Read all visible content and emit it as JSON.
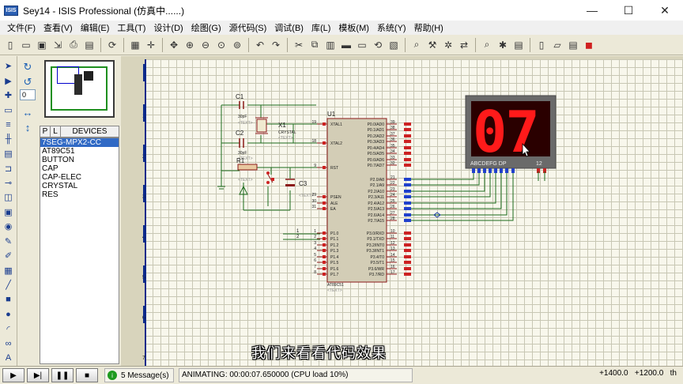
{
  "window": {
    "app_icon_label": "ISIS",
    "title": "Sey14 - ISIS Professional (仿真中......)",
    "minimize": "—",
    "maximize": "☐",
    "close": "✕"
  },
  "menu": [
    "文件(F)",
    "查看(V)",
    "编辑(E)",
    "工具(T)",
    "设计(D)",
    "绘图(G)",
    "源代码(S)",
    "调试(B)",
    "库(L)",
    "模板(M)",
    "系统(Y)",
    "帮助(H)"
  ],
  "toolbar_icons": [
    "new-file-icon",
    "open-folder-icon",
    "save-icon",
    "import-icon",
    "print-icon",
    "print-area-icon",
    "refresh-icon",
    "grid-icon",
    "origin-icon",
    "pan-icon",
    "zoom-in-icon",
    "zoom-out-icon",
    "zoom-all-icon",
    "zoom-area-icon",
    "undo-icon",
    "redo-icon",
    "cut-icon",
    "copy-icon",
    "paste-icon",
    "block-copy-icon",
    "block-move-icon",
    "block-rotate-icon",
    "block-delete-icon",
    "pick-device-icon",
    "make-device-icon",
    "decompose-icon",
    "wire-autoroute-icon",
    "search-icon",
    "property-tool-icon",
    "design-explorer-icon",
    "new-sheet-icon",
    "remove-sheet-icon",
    "bom-icon",
    "ares-icon"
  ],
  "side": {
    "angle": "0",
    "tabs": [
      "P",
      "L"
    ],
    "devices_title": "DEVICES",
    "devices": [
      "7SEG-MPX2-CC",
      "AT89C51",
      "BUTTON",
      "CAP",
      "CAP-ELEC",
      "CRYSTAL",
      "RES"
    ],
    "selected_index": 0
  },
  "schematic": {
    "c1": "C1",
    "c1_val": "30pF",
    "c2": "C2",
    "c2_val": "30pF",
    "x1": "X1",
    "x1_val": "CRYSTAL",
    "r1": "R1",
    "c3": "C3",
    "u1": "U1",
    "u1_part": "AT89C51",
    "text_tag": "<TEXT>",
    "display_digits": "07",
    "display_seg_label": "ABCDEFG  DP",
    "display_com_label": "12",
    "net_1": "1",
    "net_2": "2",
    "u1_left_pins": [
      {
        "num": "19",
        "name": "XTAL1"
      },
      {
        "num": "18",
        "name": "XTAL2"
      },
      {
        "num": "9",
        "name": "RST"
      },
      {
        "num": "29",
        "name": "PSEN"
      },
      {
        "num": "30",
        "name": "ALE"
      },
      {
        "num": "31",
        "name": "EA"
      },
      {
        "num": "1",
        "name": "P1.0"
      },
      {
        "num": "2",
        "name": "P1.1"
      },
      {
        "num": "3",
        "name": "P1.2"
      },
      {
        "num": "4",
        "name": "P1.3"
      },
      {
        "num": "5",
        "name": "P1.4"
      },
      {
        "num": "6",
        "name": "P1.5"
      },
      {
        "num": "7",
        "name": "P1.6"
      },
      {
        "num": "8",
        "name": "P1.7"
      }
    ],
    "u1_right_pins": [
      {
        "num": "39",
        "name": "P0.0/AD0"
      },
      {
        "num": "38",
        "name": "P0.1/AD1"
      },
      {
        "num": "37",
        "name": "P0.2/AD2"
      },
      {
        "num": "36",
        "name": "P0.3/AD3"
      },
      {
        "num": "35",
        "name": "P0.4/AD4"
      },
      {
        "num": "34",
        "name": "P0.5/AD5"
      },
      {
        "num": "33",
        "name": "P0.6/AD6"
      },
      {
        "num": "32",
        "name": "P0.7/AD7"
      },
      {
        "num": "21",
        "name": "P2.0/A8"
      },
      {
        "num": "22",
        "name": "P2.1/A9"
      },
      {
        "num": "23",
        "name": "P2.2/A10"
      },
      {
        "num": "24",
        "name": "P2.3/A11"
      },
      {
        "num": "25",
        "name": "P2.4/A12"
      },
      {
        "num": "26",
        "name": "P2.5/A13"
      },
      {
        "num": "27",
        "name": "P2.6/A14"
      },
      {
        "num": "28",
        "name": "P2.7/A15"
      },
      {
        "num": "10",
        "name": "P3.0/RXD"
      },
      {
        "num": "11",
        "name": "P3.1/TXD"
      },
      {
        "num": "12",
        "name": "P3.2/INT0"
      },
      {
        "num": "13",
        "name": "P3.3/INT1"
      },
      {
        "num": "14",
        "name": "P3.4/T0"
      },
      {
        "num": "15",
        "name": "P3.5/T1"
      },
      {
        "num": "16",
        "name": "P3.6/WR"
      },
      {
        "num": "17",
        "name": "P3.7/RD"
      }
    ],
    "ruler_marks": [
      "1",
      "2",
      "3",
      "4",
      "5",
      "6",
      "7"
    ]
  },
  "subtitle": "我们来看看代码效果",
  "status": {
    "messages": "5 Message(s)",
    "animating": "ANIMATING: 00:00:07.650000 (CPU load 10%)",
    "coord_x": "+1400.0",
    "coord_y": "+1200.0",
    "unit": "th"
  },
  "colors": {
    "sheet": "#f8f7ec",
    "wire": "#1d6b1d",
    "component": "#8b1a1a",
    "chip_fill": "#d3cdb6",
    "display_on": "#ff1a1a",
    "selection": "#316ac5"
  }
}
